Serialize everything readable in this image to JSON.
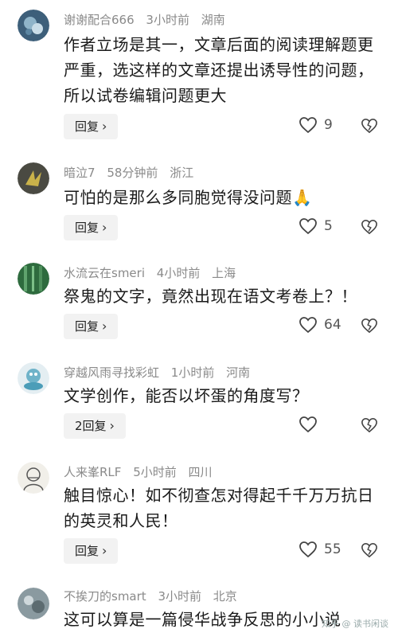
{
  "comments": [
    {
      "username": "谢谢配合666",
      "time": "3小时前",
      "location": "湖南",
      "text": "作者立场是其一，文章后面的阅读理解题更严重，选这样的文章还提出诱导性的问题，所以试卷编辑问题更大",
      "reply_label": "回复",
      "likes": "9"
    },
    {
      "username": "暗泣7",
      "time": "58分钟前",
      "location": "浙江",
      "text": "可怕的是那么多同胞觉得没问题🙏",
      "reply_label": "回复",
      "likes": "5"
    },
    {
      "username": "水流云在smeri",
      "time": "4小时前",
      "location": "上海",
      "text": "祭鬼的文字，竟然出现在语文考卷上？！",
      "reply_label": "回复",
      "likes": "64"
    },
    {
      "username": "穿越风雨寻找彩虹",
      "time": "1小时前",
      "location": "河南",
      "text": "文学创作，能否以坏蛋的角度写？",
      "reply_label": "2回复",
      "likes": ""
    },
    {
      "username": "人来峯RLF",
      "time": "5小时前",
      "location": "四川",
      "text": "触目惊心！如不彻查怎对得起千千万万抗日的英灵和人民！",
      "reply_label": "回复",
      "likes": "55"
    },
    {
      "username": "不挨刀的smart",
      "time": "3小时前",
      "location": "北京",
      "text": "这可以算是一篇侵华战争反思的小小说",
      "reply_label": "",
      "likes": ""
    }
  ],
  "watermark": "知乎 @ 读书闲谈",
  "icons": {
    "reply_chevron": "chevron-right-icon",
    "like": "heart-icon",
    "dislike": "broken-heart-icon"
  }
}
